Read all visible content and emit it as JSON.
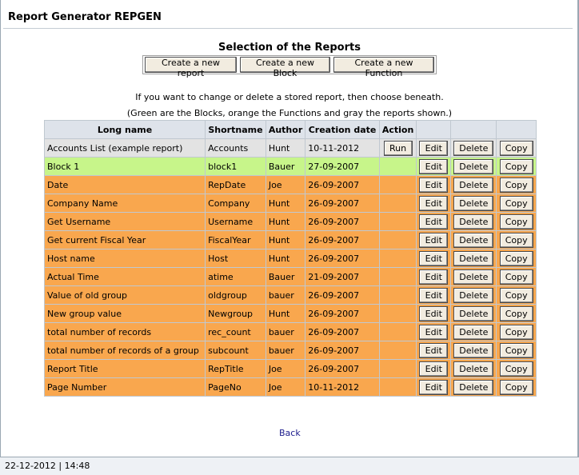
{
  "header": {
    "title": "Report Generator REPGEN"
  },
  "main": {
    "section_title": "Selection of the Reports",
    "buttons": {
      "new_report": "Create a new report",
      "new_block": "Create a new Block",
      "new_function": "Create a new Function"
    },
    "note1": "If you want to change or delete a stored report, then choose beneath.",
    "note2": "(Green are the Blocks, orange the Functions and gray the reports shown.)"
  },
  "table": {
    "headers": {
      "long_name": "Long name",
      "short_name": "Shortname",
      "author": "Author",
      "creation_date": "Creation date",
      "action": "Action"
    },
    "action_labels": {
      "run": "Run",
      "edit": "Edit",
      "delete": "Delete",
      "copy": "Copy"
    },
    "colors": {
      "report": "#e3e3e3",
      "block": "#c7f58a",
      "function": "#f9a74e"
    },
    "rows": [
      {
        "long": "Accounts List (example report)",
        "short": "Accounts",
        "author": "Hunt",
        "date": "10-11-2012"
      },
      {
        "long": "Block 1",
        "short": "block1",
        "author": "Bauer",
        "date": "27-09-2007"
      },
      {
        "long": "Date",
        "short": "RepDate",
        "author": "Joe",
        "date": "26-09-2007"
      },
      {
        "long": "Company Name",
        "short": "Company",
        "author": "Hunt",
        "date": "26-09-2007"
      },
      {
        "long": "Get Username",
        "short": "Username",
        "author": "Hunt",
        "date": "26-09-2007"
      },
      {
        "long": "Get current Fiscal Year",
        "short": "FiscalYear",
        "author": "Hunt",
        "date": "26-09-2007"
      },
      {
        "long": "Host name",
        "short": "Host",
        "author": "Hunt",
        "date": "26-09-2007"
      },
      {
        "long": "Actual Time",
        "short": "atime",
        "author": "Bauer",
        "date": "21-09-2007"
      },
      {
        "long": "Value of old group",
        "short": "oldgroup",
        "author": "bauer",
        "date": "26-09-2007"
      },
      {
        "long": "New group value",
        "short": "Newgroup",
        "author": "Hunt",
        "date": "26-09-2007"
      },
      {
        "long": "total number of records",
        "short": "rec_count",
        "author": "bauer",
        "date": "26-09-2007"
      },
      {
        "long": "total number of records of a group",
        "short": "subcount",
        "author": "bauer",
        "date": "26-09-2007"
      },
      {
        "long": "Report Title",
        "short": "RepTitle",
        "author": "Joe",
        "date": "26-09-2007"
      },
      {
        "long": "Page Number",
        "short": "PageNo",
        "author": "Joe",
        "date": "10-11-2012"
      }
    ]
  },
  "footer": {
    "back_label": "Back",
    "status": "22-12-2012 | 14:48"
  }
}
